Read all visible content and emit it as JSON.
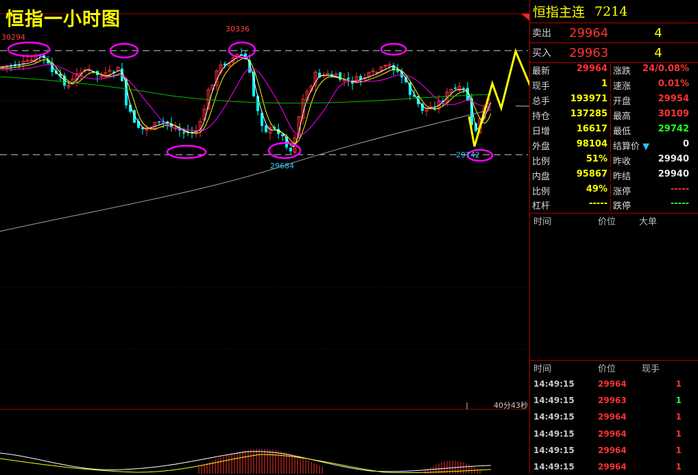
{
  "chart": {
    "title": "恒指一小时图",
    "timer": "40分43秒",
    "peak_labels": [
      "30294",
      "30336",
      "29684",
      "29742"
    ],
    "colors": {
      "up": "#ff3030",
      "down": "#00ffff",
      "ma5": "#ffffff",
      "ma10": "#ffff00",
      "ma20": "#ff00ff",
      "ma60": "#00c000",
      "ma250": "#a0a0a0",
      "annotation": "#ff00ff",
      "forecast": "#ffff00"
    }
  },
  "panel": {
    "title": "恒指主连",
    "code": "7214",
    "sell": {
      "label": "卖出",
      "price": "29964",
      "qty": "4"
    },
    "buy": {
      "label": "买入",
      "price": "29963",
      "qty": "4"
    },
    "stats": [
      {
        "l1": "最新",
        "v1": "29964",
        "c1": "red",
        "l2": "涨跌",
        "v2": "24/0.08%",
        "c2": "red"
      },
      {
        "l1": "现手",
        "v1": "1",
        "c1": "yellow",
        "l2": "速涨",
        "v2": "0.01%",
        "c2": "red"
      },
      {
        "l1": "总手",
        "v1": "193971",
        "c1": "yellow",
        "l2": "开盘",
        "v2": "29954",
        "c2": "red"
      },
      {
        "l1": "持仓",
        "v1": "137285",
        "c1": "yellow",
        "l2": "最高",
        "v2": "30109",
        "c2": "red"
      },
      {
        "l1": "日增",
        "v1": "16617",
        "c1": "yellow",
        "l2": "最低",
        "v2": "29742",
        "c2": "green"
      },
      {
        "l1": "外盘",
        "v1": "98104",
        "c1": "yellow",
        "l2": "结算价",
        "v2": "0",
        "c2": "white"
      },
      {
        "l1": "比例",
        "v1": "51%",
        "c1": "yellow",
        "l2": "昨收",
        "v2": "29940",
        "c2": "white"
      },
      {
        "l1": "内盘",
        "v1": "95867",
        "c1": "yellow",
        "l2": "昨结",
        "v2": "29940",
        "c2": "white"
      },
      {
        "l1": "比例",
        "v1": "49%",
        "c1": "yellow",
        "l2": "涨停",
        "v2": "-----",
        "c2": "red"
      },
      {
        "l1": "杠杆",
        "v1": "-----",
        "c1": "yellow",
        "l2": "跌停",
        "v2": "-----",
        "c2": "green"
      }
    ],
    "big_orders_header": {
      "time": "时间",
      "price": "价位",
      "big": "大单"
    },
    "ticks_header": {
      "time": "时间",
      "price": "价位",
      "vol": "现手"
    },
    "ticks": [
      {
        "time": "14:49:15",
        "price": "29964",
        "vol": "1",
        "vc": "red"
      },
      {
        "time": "14:49:15",
        "price": "29963",
        "vol": "1",
        "vc": "green"
      },
      {
        "time": "14:49:15",
        "price": "29964",
        "vol": "1",
        "vc": "red"
      },
      {
        "time": "14:49:15",
        "price": "29964",
        "vol": "1",
        "vc": "red"
      },
      {
        "time": "14:49:15",
        "price": "29964",
        "vol": "1",
        "vc": "red"
      },
      {
        "time": "14:49:15",
        "price": "29964",
        "vol": "1",
        "vc": "red"
      }
    ]
  }
}
